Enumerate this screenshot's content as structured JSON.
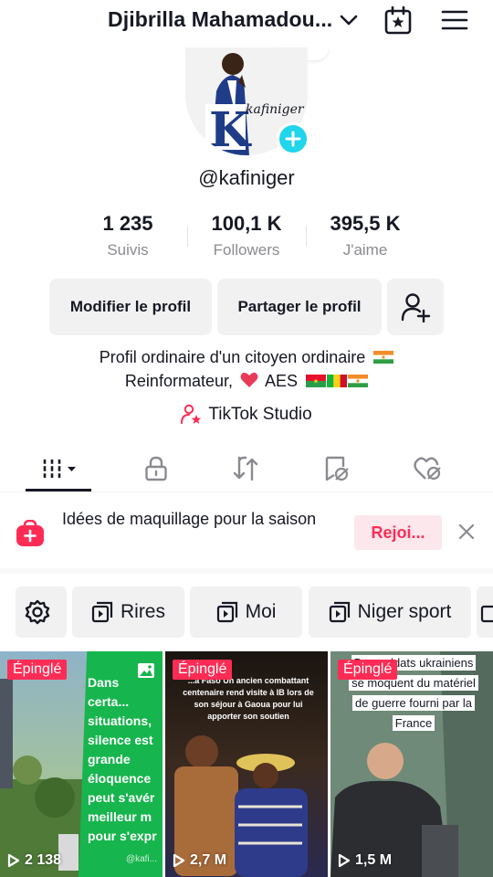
{
  "header": {
    "account_name": "Djibrilla Mahamadou...",
    "icons": [
      "chevron-down-icon",
      "calendar-star-icon",
      "hamburger-menu-icon"
    ]
  },
  "profile": {
    "avatar_text": "kafiniger",
    "username": "@kafiniger",
    "stats": [
      {
        "value": "1 235",
        "label": "Suivis"
      },
      {
        "value": "100,1 K",
        "label": "Followers"
      },
      {
        "value": "395,5 K",
        "label": "J'aime"
      }
    ],
    "buttons": {
      "edit": "Modifier le profil",
      "share": "Partager le profil"
    },
    "bio_line1": "Profil ordinaire d'un citoyen ordinaire",
    "bio_line2": "Reinformateur,",
    "bio_aes": "AES",
    "studio_label": "TikTok Studio"
  },
  "tabs": [
    "grid-icon",
    "lock-icon",
    "repost-icon",
    "saved-icon",
    "liked-icon"
  ],
  "promo": {
    "text": "Idées de maquillage pour la saison",
    "join_label": "Rejoi..."
  },
  "playlists": [
    {
      "label": "Rires"
    },
    {
      "label": "Moi"
    },
    {
      "label": "Niger sport"
    }
  ],
  "videos": [
    {
      "pinned": "Épinglé",
      "views": "2 138",
      "caption": "Dans certa...\nsituations,\nsilence est\ngrande\néloquence\npeut s'avér\nmeilleur m\npour s'expr",
      "watermark": "@kafi..."
    },
    {
      "pinned": "Épinglé",
      "views": "2,7 M",
      "caption": "...a Faso\nUn ancien combattant centenaire rend visite à IB lors de son séjour à Gaoua pour lui apporter son soutien"
    },
    {
      "pinned": "Épinglé",
      "views": "1,5 M",
      "caption": "Des soldats ukrainiens se moquent du matériel de guerre fourni par la France"
    }
  ],
  "colors": {
    "accent": "#fe2c55",
    "badge": "#20d5ec",
    "text": "#161823",
    "muted": "#8a8b91",
    "button_bg": "#f1f1f2"
  }
}
